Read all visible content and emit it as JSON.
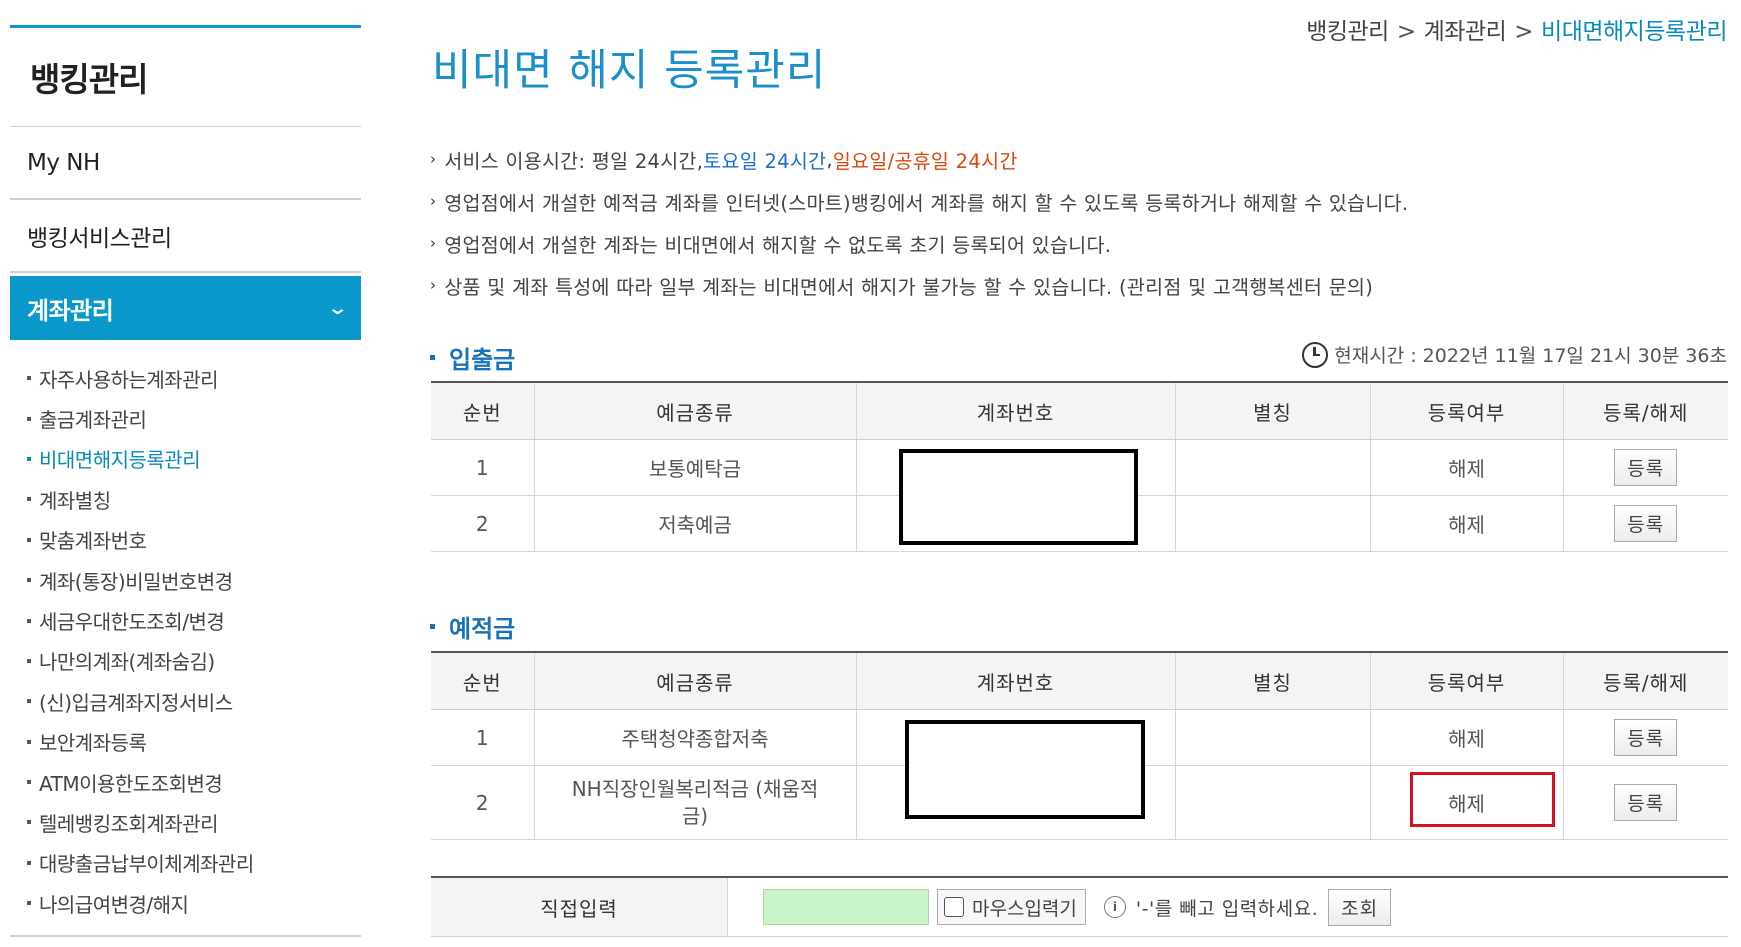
{
  "sidebar": {
    "title": "뱅킹관리",
    "items": [
      "My NH",
      "뱅킹서비스관리"
    ],
    "active": "계좌관리",
    "sub_items": [
      "자주사용하는계좌관리",
      "출금계좌관리",
      "비대면해지등록관리",
      "계좌별칭",
      "맞춤계좌번호",
      "계좌(통장)비밀번호변경",
      "세금우대한도조회/변경",
      "나만의계좌(계좌숨김)",
      "(신)입금계좌지정서비스",
      "보안계좌등록",
      "ATM이용한도조회변경",
      "텔레뱅킹조회계좌관리",
      "대량출금납부이체계좌관리",
      "나의급여변경/해지"
    ]
  },
  "breadcrumb": [
    "뱅킹관리",
    "계좌관리",
    "비대면해지등록관리"
  ],
  "page_title": "비대면 해지 등록관리",
  "notes": {
    "service_prefix": "서비스 이용시간: 평일 24시간, ",
    "service_saturday": "토요일 24시간",
    "service_comma": ", ",
    "service_holiday": "일요일/공휴일 24시간",
    "line2": "영업점에서 개설한 예적금 계좌를 인터넷(스마트)뱅킹에서 계좌를 해지 할 수 있도록 등록하거나 해제할 수 있습니다.",
    "line3": "영업점에서 개설한 계좌는 비대면에서 해지할 수 없도록 초기 등록되어 있습니다.",
    "line4": "상품 및 계좌 특성에 따라 일부 계좌는 비대면에서 해지가 불가능 할 수 있습니다. (관리점 및 고객행복센터 문의)"
  },
  "current_time": "현재시간 : 2022년 11월 17일 21시 30분 36초",
  "table_headers": [
    "순번",
    "예금종류",
    "계좌번호",
    "별칭",
    "등록여부",
    "등록/해제"
  ],
  "deposit_section": {
    "title": "입출금",
    "rows": [
      {
        "no": "1",
        "type": "보통예탁금",
        "alias": "",
        "status": "해제",
        "action": "등록"
      },
      {
        "no": "2",
        "type": "저축예금",
        "alias": "",
        "status": "해제",
        "action": "등록"
      }
    ]
  },
  "savings_section": {
    "title": "예적금",
    "rows": [
      {
        "no": "1",
        "type": "주택청약종합저축",
        "alias": "",
        "status": "해제",
        "action": "등록"
      },
      {
        "no": "2",
        "type": "NH직장인월복리적금 (채움적금)",
        "alias": "",
        "status": "해제",
        "action": "등록"
      }
    ]
  },
  "direct_input": {
    "label": "직접입력",
    "value": "",
    "mouse_label": "마우스입력기",
    "hint": "'-'를 빼고 입력하세요.",
    "search_label": "조회"
  },
  "colors": {
    "accent": "#0a97c9",
    "title_blue": "#1a8fc9",
    "highlight_red": "#d51020"
  },
  "icons": [
    "chevron-down-icon",
    "clock-icon",
    "info-icon",
    "arrow-right-icon"
  ]
}
